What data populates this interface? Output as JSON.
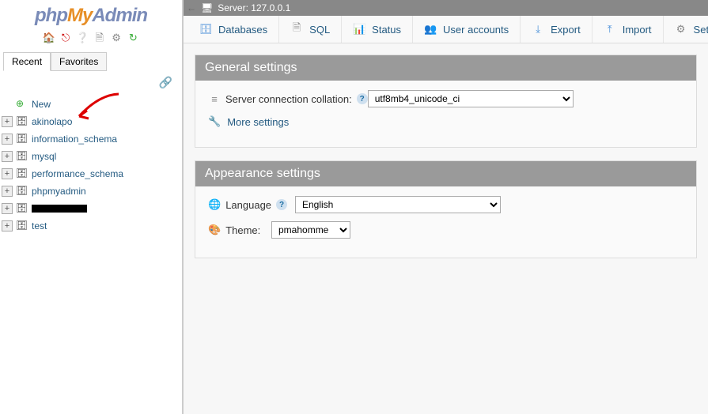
{
  "logo": {
    "p1": "php",
    "p2": "My",
    "p3": "Admin"
  },
  "sidebar_tabs": {
    "recent": "Recent",
    "favorites": "Favorites"
  },
  "tree": {
    "new_label": "New",
    "items": [
      {
        "label": "akinolapo"
      },
      {
        "label": "information_schema"
      },
      {
        "label": "mysql"
      },
      {
        "label": "performance_schema"
      },
      {
        "label": "phpmyadmin"
      },
      {
        "label": ""
      },
      {
        "label": "test"
      }
    ]
  },
  "topbar": {
    "server_label": "Server: 127.0.0.1"
  },
  "menu": {
    "databases": "Databases",
    "sql": "SQL",
    "status": "Status",
    "user_accounts": "User accounts",
    "export": "Export",
    "import": "Import",
    "settings": "Setti"
  },
  "panels": {
    "general": {
      "title": "General settings",
      "collation_label": "Server connection collation:",
      "collation_value": "utf8mb4_unicode_ci",
      "more": "More settings"
    },
    "appearance": {
      "title": "Appearance settings",
      "language_label": "Language",
      "language_value": "English",
      "theme_label": "Theme:",
      "theme_value": "pmahomme"
    }
  }
}
